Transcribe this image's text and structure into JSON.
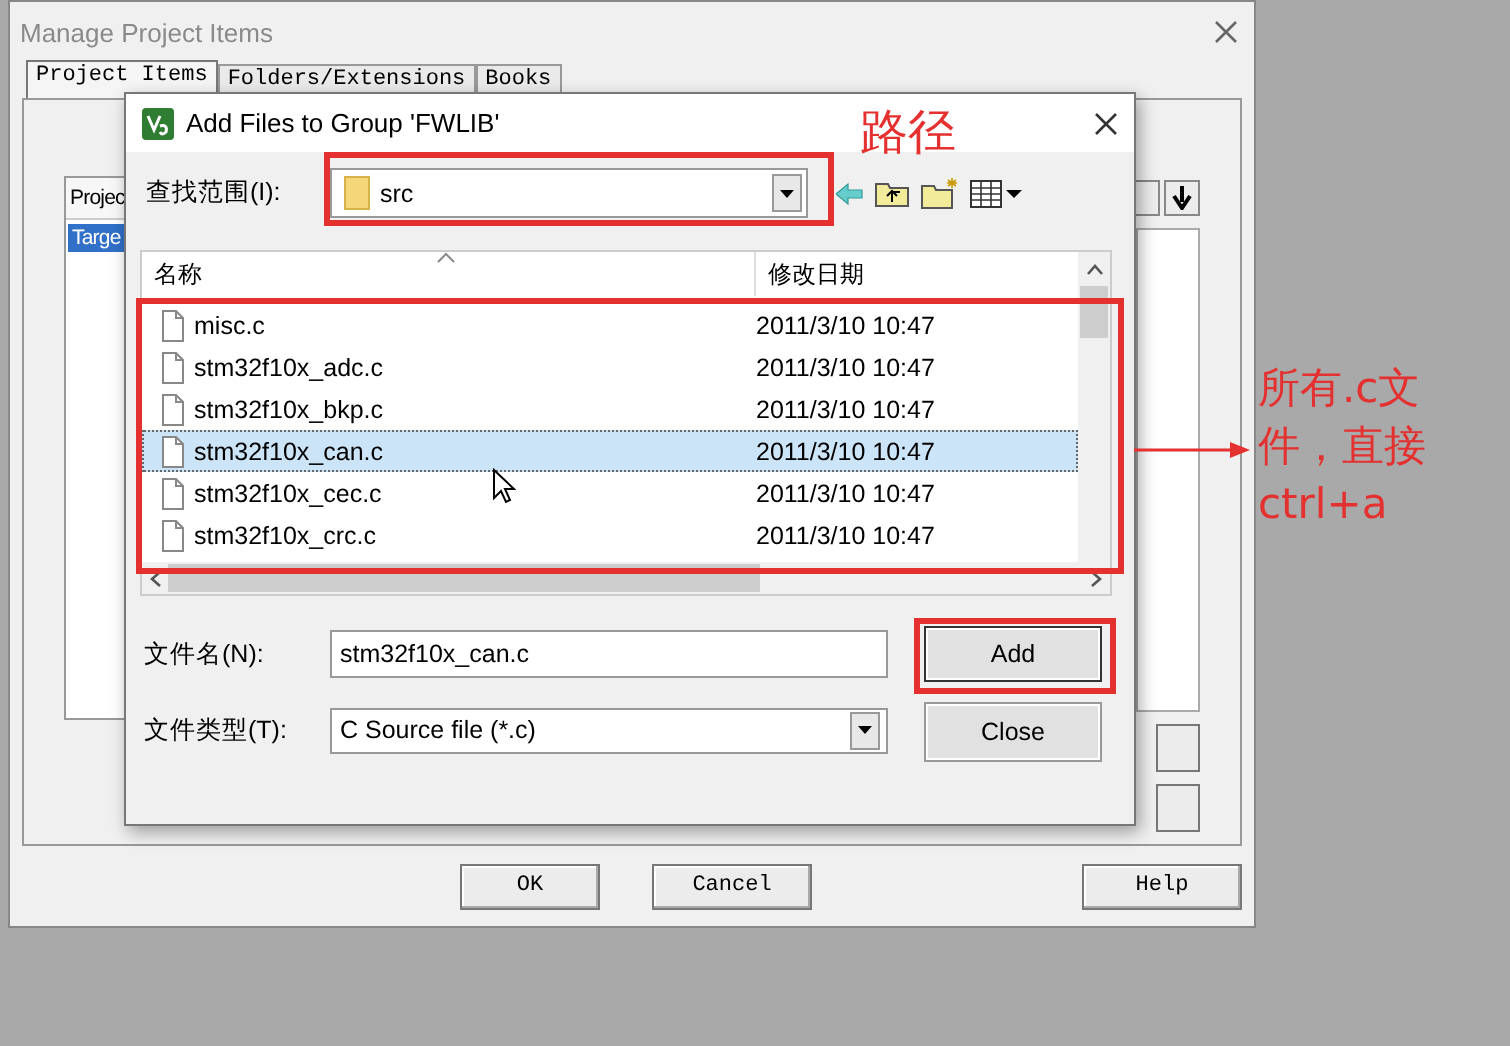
{
  "back_window": {
    "title": "Manage Project Items",
    "tabs": [
      {
        "label": "Project Items",
        "selected": true
      },
      {
        "label": "Folders/Extensions",
        "selected": false
      },
      {
        "label": "Books",
        "selected": false
      }
    ],
    "list_header": "Projec",
    "list_items": [
      {
        "label": "Targe",
        "selected": true
      }
    ],
    "buttons": [
      "OK",
      "Cancel",
      "Help"
    ]
  },
  "dialog": {
    "title": "Add Files to Group 'FWLIB'",
    "look_in_label": "查找范围(I):",
    "look_in_value": "src",
    "columns": [
      "名称",
      "修改日期"
    ],
    "files": [
      {
        "name": "misc.c",
        "modified": "2011/3/10 10:47",
        "selected": false
      },
      {
        "name": "stm32f10x_adc.c",
        "modified": "2011/3/10 10:47",
        "selected": false
      },
      {
        "name": "stm32f10x_bkp.c",
        "modified": "2011/3/10 10:47",
        "selected": false
      },
      {
        "name": "stm32f10x_can.c",
        "modified": "2011/3/10 10:47",
        "selected": true
      },
      {
        "name": "stm32f10x_cec.c",
        "modified": "2011/3/10 10:47",
        "selected": false
      },
      {
        "name": "stm32f10x_crc.c",
        "modified": "2011/3/10 10:47",
        "selected": false
      }
    ],
    "file_name_label": "文件名(N):",
    "file_name_value": "stm32f10x_can.c",
    "file_type_label": "文件类型(T):",
    "file_type_value": "C Source file (*.c)",
    "buttons": [
      "Add",
      "Close"
    ]
  },
  "annotations": {
    "path_label": "路径",
    "note_lines": [
      "所有.c文",
      "件，直接",
      "ctrl+a"
    ]
  }
}
